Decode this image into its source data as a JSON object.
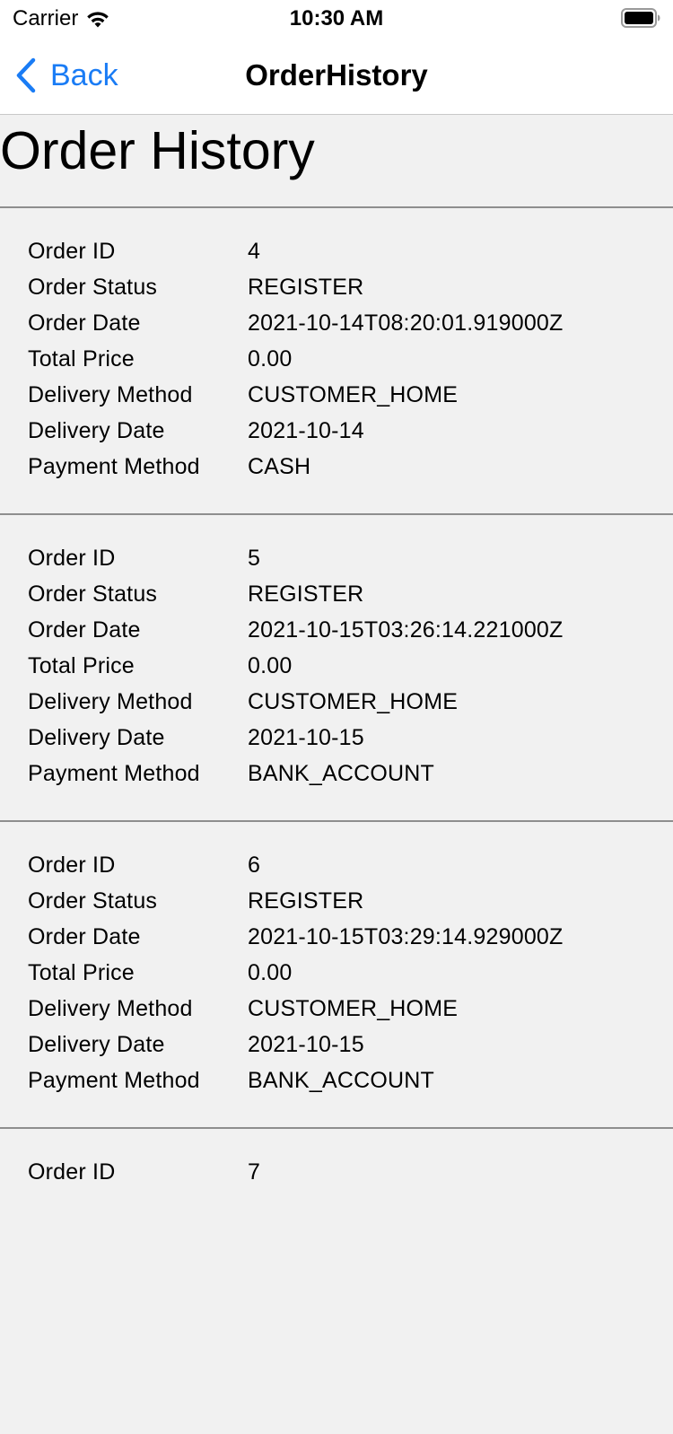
{
  "status_bar": {
    "carrier": "Carrier",
    "time": "10:30 AM",
    "wifi_icon": "wifi-icon",
    "battery_icon": "battery-icon"
  },
  "nav": {
    "back_label": "Back",
    "title": "OrderHistory",
    "accent": "#1a7cf5"
  },
  "page_title": "Order History",
  "field_labels": {
    "order_id": "Order ID",
    "order_status": "Order Status",
    "order_date": "Order Date",
    "total_price": "Total Price",
    "delivery_method": "Delivery Method",
    "delivery_date": "Delivery Date",
    "payment_method": "Payment Method"
  },
  "orders": [
    {
      "order_id": "4",
      "order_status": "REGISTER",
      "order_date": "2021-10-14T08:20:01.919000Z",
      "total_price": "0.00",
      "delivery_method": "CUSTOMER_HOME",
      "delivery_date": "2021-10-14",
      "payment_method": "CASH"
    },
    {
      "order_id": "5",
      "order_status": "REGISTER",
      "order_date": "2021-10-15T03:26:14.221000Z",
      "total_price": "0.00",
      "delivery_method": "CUSTOMER_HOME",
      "delivery_date": "2021-10-15",
      "payment_method": "BANK_ACCOUNT"
    },
    {
      "order_id": "6",
      "order_status": "REGISTER",
      "order_date": "2021-10-15T03:29:14.929000Z",
      "total_price": "0.00",
      "delivery_method": "CUSTOMER_HOME",
      "delivery_date": "2021-10-15",
      "payment_method": "BANK_ACCOUNT"
    },
    {
      "order_id": "7"
    }
  ]
}
